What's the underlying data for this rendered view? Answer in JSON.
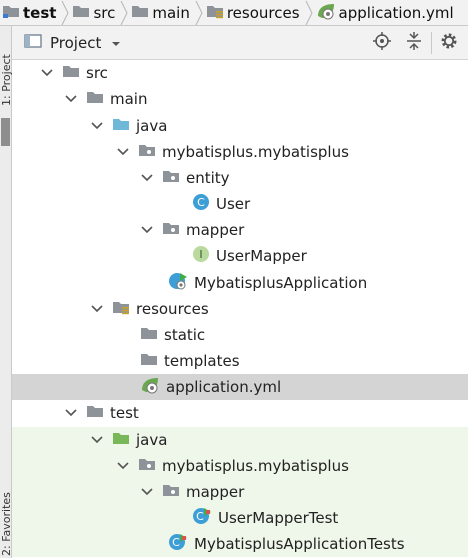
{
  "breadcrumb": {
    "items": [
      {
        "label": "test",
        "icon": "module-folder-icon"
      },
      {
        "label": "src",
        "icon": "folder-icon"
      },
      {
        "label": "main",
        "icon": "folder-icon"
      },
      {
        "label": "resources",
        "icon": "resources-folder-icon"
      },
      {
        "label": "application.yml",
        "icon": "spring-config-icon"
      }
    ]
  },
  "tool_strip": {
    "project_label": "1: Project",
    "favorites_label": "2: Favorites"
  },
  "panel": {
    "title": "Project",
    "icons": [
      "locate-icon",
      "collapse-all-icon",
      "settings-icon"
    ]
  },
  "tree": {
    "src": "src",
    "main": "main",
    "java": "java",
    "package_main": "mybatisplus.mybatisplus",
    "entity": "entity",
    "user": "User",
    "mapper": "mapper",
    "user_mapper": "UserMapper",
    "app": "MybatisplusApplication",
    "resources": "resources",
    "static": "static",
    "templates": "templates",
    "app_yml": "application.yml",
    "test": "test",
    "test_java": "java",
    "package_test": "mybatisplus.mybatisplus",
    "test_mapper": "mapper",
    "user_mapper_test": "UserMapperTest",
    "app_tests": "MybatisplusApplicationTests"
  },
  "colors": {
    "selection": "#d4d4d4",
    "test_background": "#eff7ea",
    "java_source_folder": "#6fb8d8",
    "test_source_folder": "#79b858",
    "class_icon": "#3d9fd6",
    "interface_icon": "#6aa84f"
  }
}
